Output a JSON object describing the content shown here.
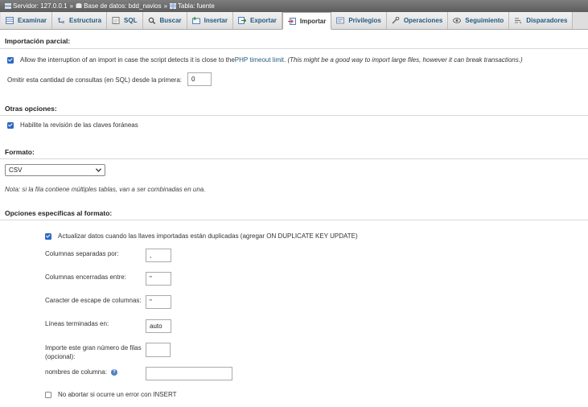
{
  "breadcrumb": {
    "server": "Servidor: 127.0.0.1",
    "database": "Base de datos: bdd_navios",
    "table": "Tabla: fuente",
    "separator": "»"
  },
  "tabs": [
    {
      "label": "Examinar",
      "icon": "browse-icon"
    },
    {
      "label": "Estructura",
      "icon": "structure-icon"
    },
    {
      "label": "SQL",
      "icon": "sql-icon"
    },
    {
      "label": "Buscar",
      "icon": "search-icon"
    },
    {
      "label": "Insertar",
      "icon": "insert-icon"
    },
    {
      "label": "Exportar",
      "icon": "export-icon"
    },
    {
      "label": "Importar",
      "icon": "import-icon",
      "active": true
    },
    {
      "label": "Privilegios",
      "icon": "privileges-icon"
    },
    {
      "label": "Operaciones",
      "icon": "operations-icon"
    },
    {
      "label": "Seguimiento",
      "icon": "tracking-icon"
    },
    {
      "label": "Disparadores",
      "icon": "triggers-icon"
    }
  ],
  "partial": {
    "title": "Importación parcial:",
    "allow_interrupt": {
      "checked": true,
      "label_pre": "Allow the interruption of an import in case the script detects it is close to the ",
      "label_link": "PHP timeout limit",
      "label_post": ".",
      "note": "(This might be a good way to import large files, however it can break transactions.)"
    },
    "skip_label": "Omitir esta cantidad de consultas (en SQL) desde la primera:",
    "skip_value": "0"
  },
  "other": {
    "title": "Otras opciones:",
    "foreign_keys": {
      "checked": true,
      "label": "Habilite la revisión de las claves foráneas"
    }
  },
  "format": {
    "title": "Formato:",
    "selected": "CSV",
    "note": "Nota: si la fila contiene múltiples tablas, van a ser combinadas en una."
  },
  "specific": {
    "title": "Opciones específicas al formato:",
    "update_duplicates": {
      "checked": true,
      "label": "Actualizar datos cuando las llaves importadas están duplicadas (agregar ON DUPLICATE KEY UPDATE)"
    },
    "fields": [
      {
        "label": "Columnas separadas por:",
        "value": ","
      },
      {
        "label": "Columnas encerradas entre:",
        "value": "\""
      },
      {
        "label": "Caracter de escape de columnas:",
        "value": "\""
      },
      {
        "label": "Líneas terminadas en:",
        "value": "auto"
      }
    ],
    "rows_label_1": "Importe este gran número de filas",
    "rows_label_2": "(opcional):",
    "rows_value": "",
    "colnames_label": "nombres de columna:",
    "colnames_value": "",
    "no_abort": {
      "checked": false,
      "label": "No abortar si ocurre un error con INSERT"
    }
  }
}
